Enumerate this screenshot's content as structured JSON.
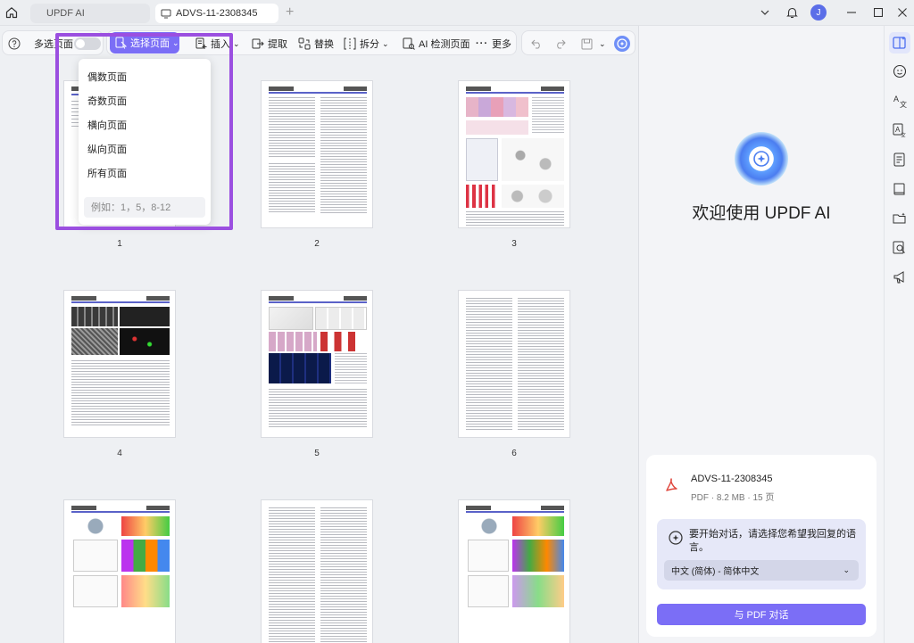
{
  "titlebar": {
    "tabs": [
      {
        "label": "UPDF AI"
      },
      {
        "label": "ADVS-11-2308345"
      }
    ],
    "add_tab": "+",
    "avatar_initial": "J"
  },
  "toolbar": {
    "multi_select_label": "多选页面",
    "select_pages_label": "选择页面",
    "insert_label": "插入",
    "extract_label": "提取",
    "replace_label": "替换",
    "split_label": "拆分",
    "ai_detect_label": "AI 检测页面",
    "more_label": "更多"
  },
  "dropdown": {
    "items": [
      "偶数页面",
      "奇数页面",
      "横向页面",
      "纵向页面",
      "所有页面"
    ],
    "range_placeholder": "例如：1，5，8-12"
  },
  "pages": {
    "numbers": [
      "1",
      "2",
      "3",
      "4",
      "5",
      "6"
    ]
  },
  "ai_panel": {
    "welcome": "欢迎使用 UPDF AI",
    "file_name": "ADVS-11-2308345",
    "file_meta": "PDF · 8.2 MB · 15 页",
    "language_prompt": "要开始对话，请选择您希望我回复的语言。",
    "language_selected": "中文 (简体) - 简体中文",
    "chat_button": "与 PDF 对话"
  },
  "colors": {
    "accent": "#7b6ef6",
    "highlight": "#9b4fe0"
  }
}
